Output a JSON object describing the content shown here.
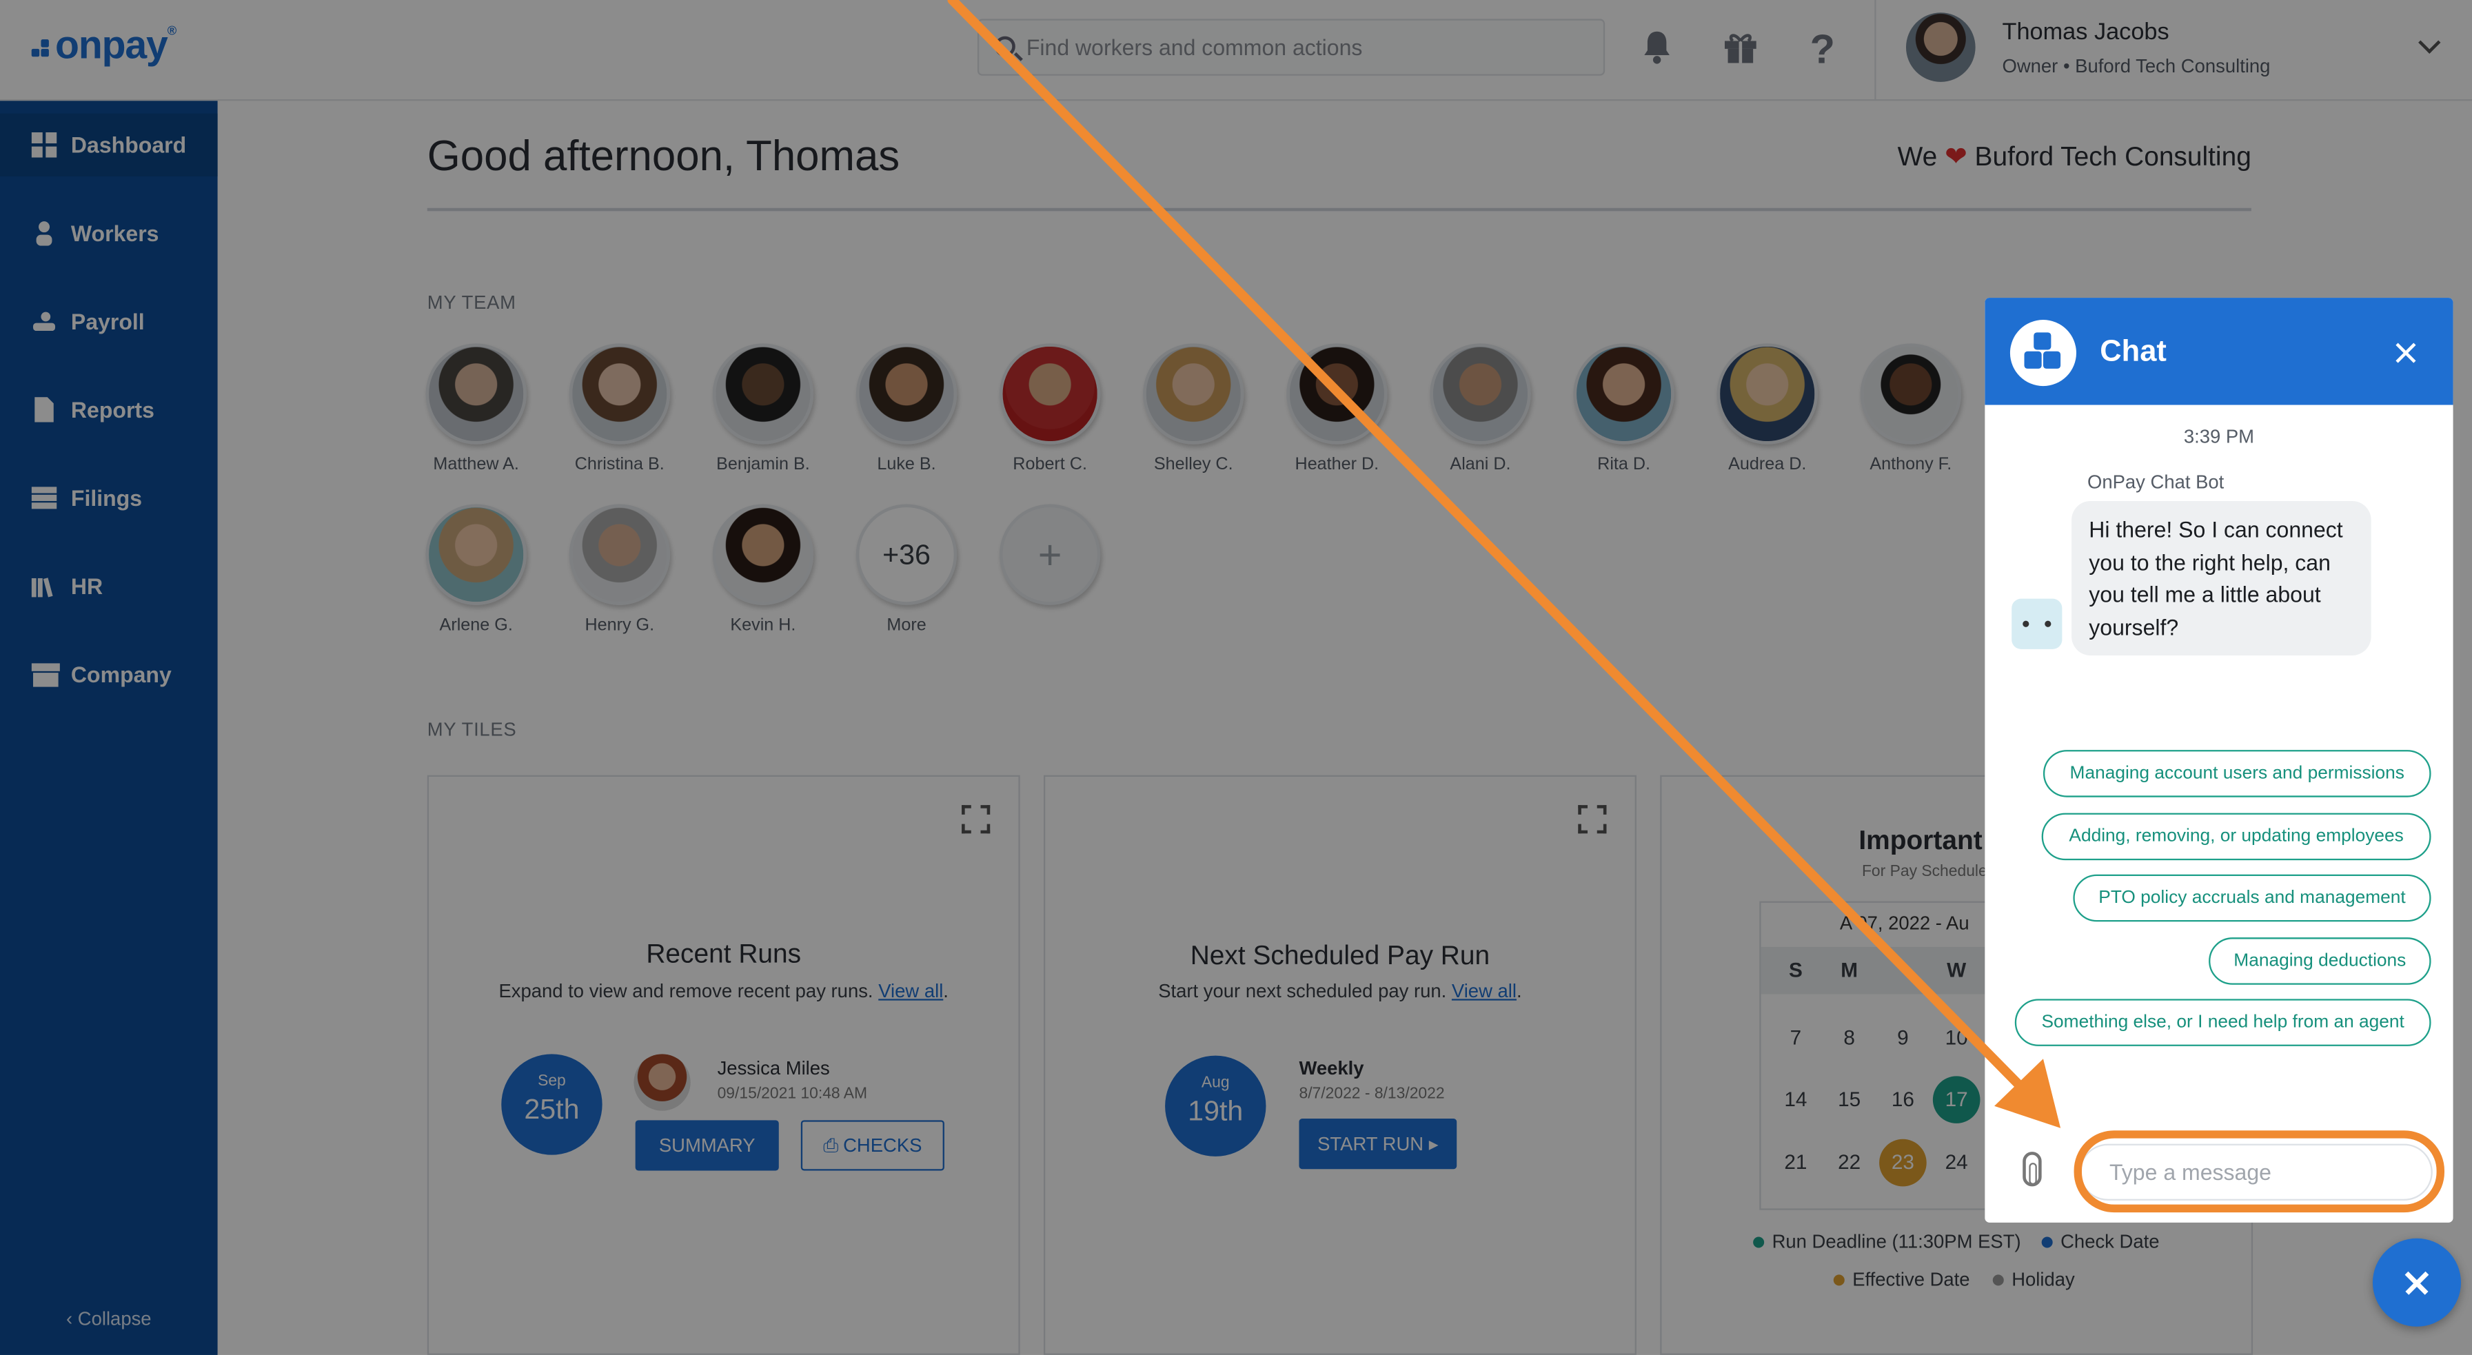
{
  "brand": {
    "logo_text": "onpay",
    "accent": "#1f6fd1",
    "sidebar_bg": "#0d4e9a"
  },
  "topbar": {
    "search_placeholder": "Find workers and common actions",
    "icons": [
      "bell-icon",
      "gift-icon",
      "help-icon"
    ],
    "user": {
      "name": "Thomas Jacobs",
      "role": "Owner • Buford Tech Consulting"
    }
  },
  "sidebar": {
    "items": [
      {
        "label": "Dashboard",
        "icon": "dashboard-icon"
      },
      {
        "label": "Workers",
        "icon": "workers-icon"
      },
      {
        "label": "Payroll",
        "icon": "payroll-icon"
      },
      {
        "label": "Reports",
        "icon": "reports-icon"
      },
      {
        "label": "Filings",
        "icon": "filings-icon"
      },
      {
        "label": "HR",
        "icon": "hr-icon"
      },
      {
        "label": "Company",
        "icon": "company-icon"
      }
    ],
    "collapse_label": "‹ Collapse"
  },
  "main": {
    "greeting": "Good afternoon, Thomas",
    "we_love_prefix": "We",
    "we_love_company": "Buford Tech Consulting",
    "my_team_label": "MY TEAM",
    "my_tiles_label": "MY TILES",
    "team": [
      "Matthew A.",
      "Christina B.",
      "Benjamin B.",
      "Luke B.",
      "Robert C.",
      "Shelley C.",
      "Heather D.",
      "Alani D.",
      "Rita D.",
      "Audrea D.",
      "Anthony F.",
      "Arlene G.",
      "Henry G.",
      "Kevin H."
    ],
    "more": {
      "count": "+36",
      "label": "More"
    },
    "add_symbol": "+"
  },
  "tiles": {
    "recent_runs": {
      "title": "Recent Runs",
      "subtitle": "Expand to view and remove recent pay runs.",
      "link": "View all",
      "date_month": "Sep",
      "date_day": "25th",
      "person": "Jessica Miles",
      "timestamp": "09/15/2021 10:48 AM",
      "summary_btn": "SUMMARY",
      "checks_btn": "CHECKS"
    },
    "next_run": {
      "title": "Next Scheduled Pay Run",
      "subtitle": "Start your next scheduled pay run.",
      "link": "View all",
      "date_month": "Aug",
      "date_day": "19th",
      "frequency": "Weekly",
      "range": "8/7/2022 - 8/13/2022",
      "start_btn": "START RUN ▸"
    },
    "important": {
      "title": "Important",
      "subtitle": "For Pay Schedule",
      "range": "A  07, 2022 - Au",
      "weekdays": [
        "S",
        "M",
        "",
        "W"
      ],
      "weeks": [
        [
          "7",
          "8",
          "9",
          "10"
        ],
        [
          "14",
          "15",
          "16",
          "17"
        ],
        [
          "21",
          "22",
          "23",
          "24"
        ]
      ],
      "legend": [
        {
          "label": "Run Deadline (11:30PM EST)",
          "color": "#1ea08a"
        },
        {
          "label": "Check Date",
          "color": "#1f6fd1"
        },
        {
          "label": "Effective Date",
          "color": "#e0a030"
        },
        {
          "label": "Holiday",
          "color": "#999999"
        }
      ]
    }
  },
  "chat": {
    "title": "Chat",
    "time": "3:39 PM",
    "bot_name": "OnPay Chat Bot",
    "message": "Hi there! So I can connect you to the right help, can you tell me a little about yourself?",
    "options": [
      "Managing account users and permissions",
      "Adding, removing, or updating employees",
      "PTO policy accruals and management",
      "Managing deductions",
      "Something else, or I need help from an agent"
    ],
    "input_placeholder": "Type a message"
  },
  "annotation_color": "#f08a30"
}
